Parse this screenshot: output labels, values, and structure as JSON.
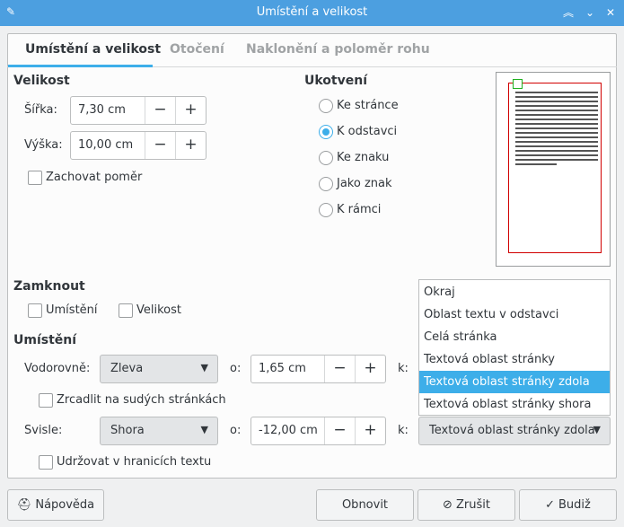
{
  "window": {
    "title": "Umístění a velikost",
    "pin_icon": "pin-icon",
    "controls": [
      "chevron-up-icon",
      "chevron-down-icon",
      "close-icon"
    ]
  },
  "tabs": [
    {
      "label": "Umístění a velikost"
    },
    {
      "label": "Otočení"
    },
    {
      "label": "Naklonění a poloměr rohu"
    }
  ],
  "size": {
    "title": "Velikost",
    "width_label": "Šířka:",
    "width_value": "7,30 cm",
    "height_label": "Výška:",
    "height_value": "10,00 cm",
    "keep_ratio_label": "Zachovat poměr"
  },
  "anchor": {
    "title": "Ukotvení",
    "options": [
      {
        "label": "Ke stránce",
        "checked": false
      },
      {
        "label": "K odstavci",
        "checked": true
      },
      {
        "label": "Ke znaku",
        "checked": false
      },
      {
        "label": "Jako znak",
        "checked": false
      },
      {
        "label": "K rámci",
        "checked": false
      }
    ]
  },
  "lock": {
    "title": "Zamknout",
    "position_label": "Umístění",
    "size_label": "Velikost"
  },
  "position": {
    "title": "Umístění",
    "horizontal_label": "Vodorovně:",
    "horizontal_value": "Zleva",
    "h_by_label": "o:",
    "h_by_value": "1,65 cm",
    "h_to_label": "k:",
    "mirror_label": "Zrcadlit na sudých stránkách",
    "vertical_label": "Svisle:",
    "vertical_value": "Shora",
    "v_by_label": "o:",
    "v_by_value": "-12,00 cm",
    "v_to_label": "k:",
    "v_to_value": "Textová oblast stránky zdola",
    "keep_inside_label": "Udržovat v hranicích textu"
  },
  "dropdown_options": [
    {
      "label": "Okraj",
      "selected": false
    },
    {
      "label": "Oblast textu v odstavci",
      "selected": false
    },
    {
      "label": "Celá stránka",
      "selected": false
    },
    {
      "label": "Textová oblast stránky",
      "selected": false
    },
    {
      "label": "Textová oblast stránky zdola",
      "selected": true
    },
    {
      "label": "Textová oblast stránky shora",
      "selected": false
    }
  ],
  "buttons": {
    "help": "Nápověda",
    "reset": "Obnovit",
    "cancel": "Zrušit",
    "ok": "Budiž"
  },
  "colors": {
    "titlebar": "#4c9fe0",
    "accent": "#3daee9",
    "preview_page": "#d10000",
    "preview_anchor": "#20b020"
  }
}
